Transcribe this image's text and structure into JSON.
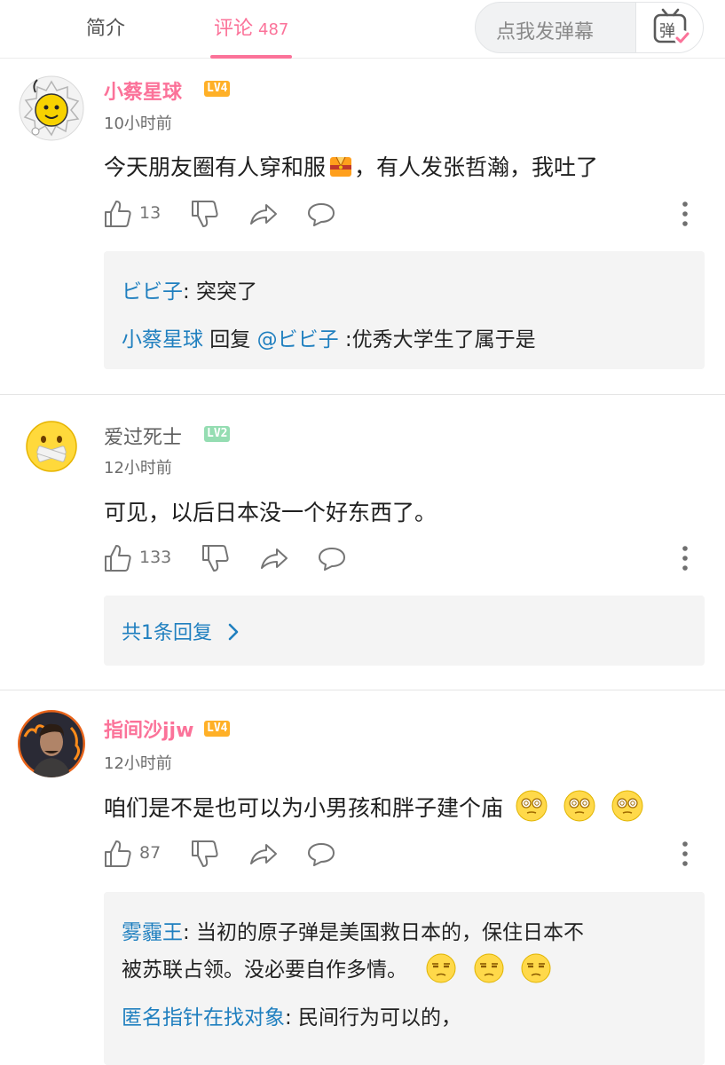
{
  "tabs": {
    "intro": "简介",
    "comments": "评论",
    "comments_count": "487"
  },
  "danmaku": {
    "placeholder": "点我发弹幕",
    "icon_char": "弹"
  },
  "comments": [
    {
      "user": "小蔡星球",
      "level": "LV4",
      "time": "10小时前",
      "text": "今天朋友圈有人穿和服",
      "text_tail": "，有人发张哲瀚，我吐了",
      "likes": "13",
      "replies": [
        {
          "user": "ビビ子",
          "text": ": 突突了"
        },
        {
          "user": "小蔡星球",
          "mid": " 回复 ",
          "mention": "@ビビ子",
          "text": " :优秀大学生了属于是"
        }
      ]
    },
    {
      "user": "爱过死士",
      "level": "LV2",
      "time": "12小时前",
      "text": "可见，以后日本没一个好东西了。",
      "likes": "133",
      "replies_link": "共1条回复"
    },
    {
      "user": "指间沙jjw",
      "level": "LV4",
      "time": "12小时前",
      "text": "咱们是不是也可以为小男孩和胖子建个庙",
      "likes": "87",
      "replies": [
        {
          "user": "雾霾王",
          "text": ": 当初的原子弹是美国救日本的，保住日本不",
          "text2": "被苏联占领。没必要自作多情。"
        },
        {
          "user": "匿名指针在找对象",
          "text": ": 民间行为可以的，"
        }
      ]
    }
  ]
}
